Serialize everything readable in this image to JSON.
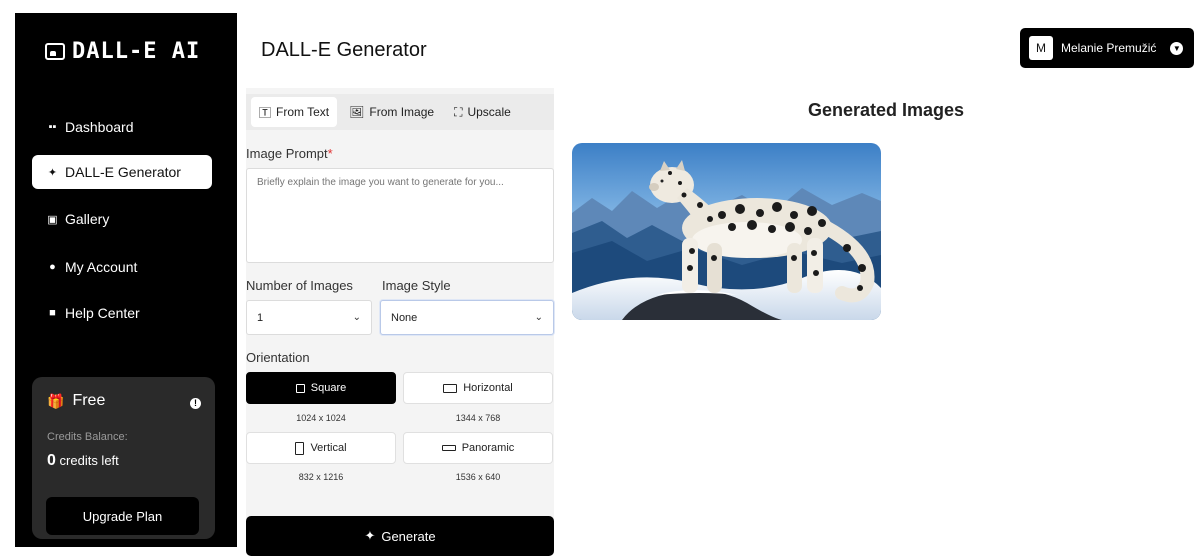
{
  "app": {
    "logo": "DALL-E AI",
    "page_title": "DALL-E Generator"
  },
  "sidebar": {
    "items": [
      {
        "label": "Dashboard",
        "icon": "dashboard-icon",
        "active": false
      },
      {
        "label": "DALL-E Generator",
        "icon": "sparkle-icon",
        "active": true
      },
      {
        "label": "Gallery",
        "icon": "gallery-icon",
        "active": false
      },
      {
        "label": "My Account",
        "icon": "user-icon",
        "active": false
      },
      {
        "label": "Help Center",
        "icon": "help-icon",
        "active": false
      }
    ],
    "plan": {
      "name": "Free",
      "credits_label": "Credits Balance:",
      "credits_count": "0",
      "credits_suffix": "credits left",
      "upgrade_label": "Upgrade Plan"
    }
  },
  "user": {
    "initial": "M",
    "name": "Melanie Premužić"
  },
  "form": {
    "tabs": [
      {
        "label": "From Text",
        "icon": "text-icon",
        "active": true
      },
      {
        "label": "From Image",
        "icon": "image-icon",
        "active": false
      },
      {
        "label": "Upscale",
        "icon": "upscale-icon",
        "active": false
      }
    ],
    "prompt_label": "Image Prompt",
    "prompt_required": "*",
    "prompt_placeholder": "Briefly explain the image you want to generate for you...",
    "prompt_value": "",
    "num_images_label": "Number of Images",
    "num_images_value": "1",
    "style_label": "Image Style",
    "style_value": "None",
    "orientation_label": "Orientation",
    "orientations": [
      {
        "label": "Square",
        "dims": "1024 x 1024",
        "active": true
      },
      {
        "label": "Horizontal",
        "dims": "1344 x 768",
        "active": false
      },
      {
        "label": "Vertical",
        "dims": "832 x 1216",
        "active": false
      },
      {
        "label": "Panoramic",
        "dims": "1536 x 640",
        "active": false
      }
    ],
    "generate_label": "Generate"
  },
  "results": {
    "title": "Generated Images",
    "images": [
      {
        "subject": "snow leopard on snowy mountain peak"
      }
    ]
  },
  "colors": {
    "primary": "#000000",
    "panel": "#f4f4f4",
    "plan_card": "#2a2a2a",
    "required": "#e03030"
  }
}
